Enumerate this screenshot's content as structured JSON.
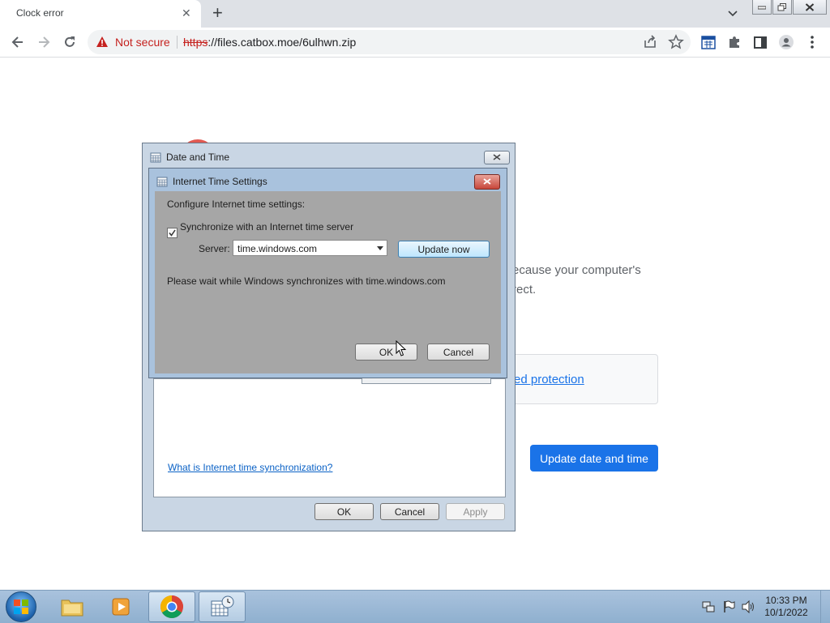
{
  "browser": {
    "tab_title": "Clock error",
    "url_scheme": "https",
    "url_rest": "://files.catbox.moe/6ulhwn.zip",
    "security_label": "Not secure"
  },
  "page": {
    "text_line1": "ecause your computer's",
    "text_line2": "rect.",
    "link_text": "ed protection",
    "update_button": "Update date and time"
  },
  "date_time_dialog": {
    "title": "Date and Time",
    "help_link": "What is Internet time synchronization?",
    "ok": "OK",
    "cancel": "Cancel",
    "apply": "Apply"
  },
  "internet_time_dialog": {
    "title": "Internet Time Settings",
    "heading": "Configure Internet time settings:",
    "sync_label": "Synchronize with an Internet time server",
    "sync_checked": true,
    "server_label": "Server:",
    "server_value": "time.windows.com",
    "update_now": "Update now",
    "status": "Please wait while Windows synchronizes with time.windows.com",
    "ok": "OK",
    "cancel": "Cancel"
  },
  "taskbar": {
    "time": "10:33 PM",
    "date": "10/1/2022"
  }
}
